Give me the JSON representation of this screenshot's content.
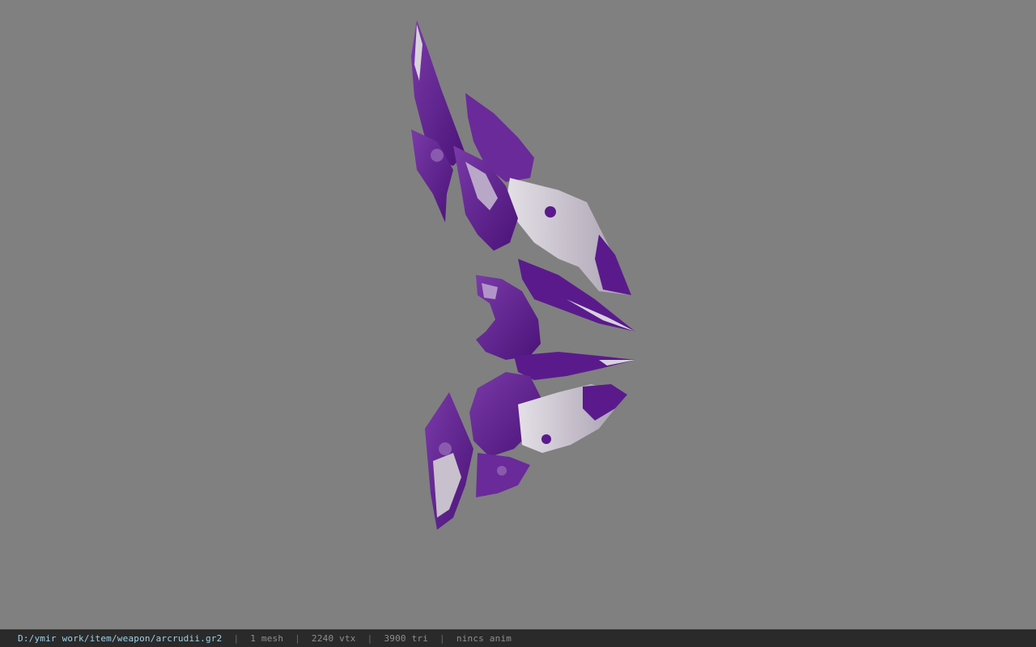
{
  "viewer": {
    "background_color": "#808080",
    "model": {
      "icon": "purple-crystal-bow-model",
      "primary_color": "#5a1a8c",
      "secondary_color": "#c8c0cc"
    }
  },
  "status": {
    "file_path": "D:/ymir work/item/weapon/arcrudii.gr2",
    "meshes": "1 mesh",
    "vertices": "2240 vtx",
    "triangles": "3900 tri",
    "animation": "nincs anim",
    "separator": "|"
  }
}
